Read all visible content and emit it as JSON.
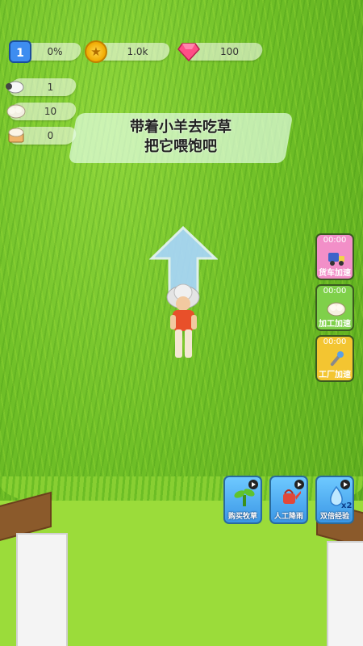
{
  "hud": {
    "level": "1",
    "progress": "0%",
    "coins": "1.0k",
    "gems": "100"
  },
  "resources": [
    {
      "icon": "sheep-icon",
      "value": "1"
    },
    {
      "icon": "wool-icon",
      "value": "10"
    },
    {
      "icon": "fabric-icon",
      "value": "0"
    }
  ],
  "hint": {
    "line1": "带着小羊去吃草",
    "line2": "把它喂饱吧"
  },
  "side_buttons": [
    {
      "name": "truck-boost",
      "timer": "00:00",
      "label": "货车加速",
      "color": "#f28fc8",
      "icon": "truck-icon"
    },
    {
      "name": "process-boost",
      "timer": "00:00",
      "label": "加工加速",
      "color": "#7fd04a",
      "icon": "wool-icon"
    },
    {
      "name": "factory-boost",
      "timer": "00:00",
      "label": "工厂加速",
      "color": "#f3c531",
      "icon": "wrench-icon"
    }
  ],
  "bottom_buttons": [
    {
      "name": "buy-pasture",
      "label": "购买牧草",
      "icon": "sprout-icon"
    },
    {
      "name": "manual-irrigation",
      "label": "人工降雨",
      "icon": "watering-can-icon"
    },
    {
      "name": "double-exp",
      "label": "双倍经验",
      "icon": "water-drop-icon",
      "badge": "x2"
    }
  ],
  "colors": {
    "grass": "#6fbf27",
    "lawn": "#9bdc3a",
    "arrow": "#9fd0ff"
  }
}
